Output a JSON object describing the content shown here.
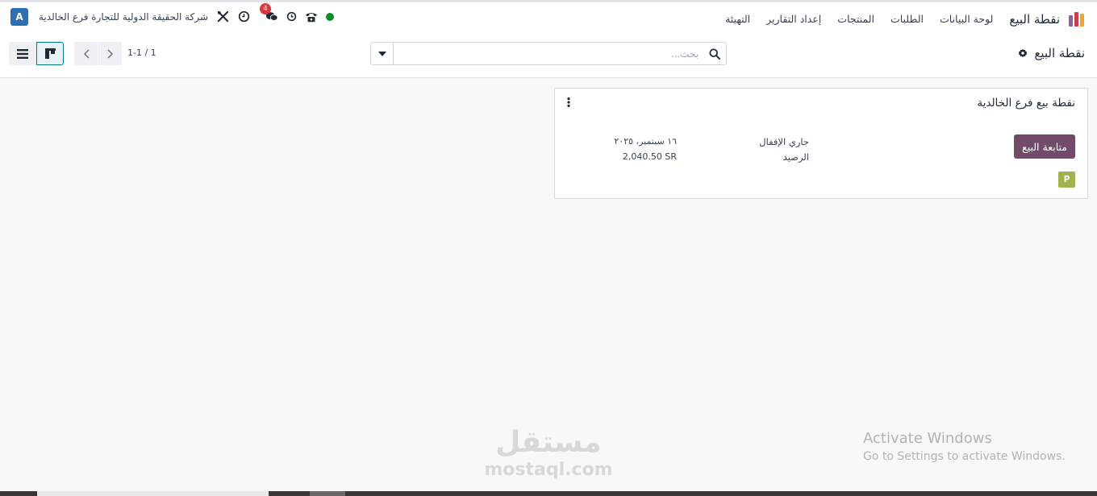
{
  "navbar": {
    "app_title": "نقطة البيع",
    "menu": [
      {
        "label": "لوحة البيانات"
      },
      {
        "label": "الطلبات"
      },
      {
        "label": "المنتجات"
      },
      {
        "label": "إعداد التقارير"
      },
      {
        "label": "التهيئة"
      }
    ],
    "company_name": "شركة الحقيقة الدولية للتجارة فرع الخالدية",
    "avatar_letter": "A",
    "messages_count": "4",
    "status_color": "#0f8a2c"
  },
  "control_panel": {
    "breadcrumb_title": "نقطة البيع",
    "search_placeholder": "بحث...",
    "pager_value": "1-1 / 1"
  },
  "card": {
    "title": "نقطة بيع فرع الخالدية",
    "primary_button": "متابعة البيع",
    "status_label": "جاري الإقفال",
    "balance_label": "الرصيد",
    "date_value": "١٦ سبتمبر، ٢٠٢٥",
    "balance_value": "2,040.50 SR",
    "user_badge": "P"
  },
  "watermarks": {
    "windows_title": "Activate Windows",
    "windows_subtitle": "Go to Settings to activate Windows.",
    "mostaql_ar": "مستقل",
    "mostaql_en": "mostaql.com"
  },
  "colors": {
    "brand_primary": "#714b67",
    "kanban_active": "#017e84",
    "avatar_bg": "#2e6fb3",
    "badge_red": "#d9363e"
  }
}
